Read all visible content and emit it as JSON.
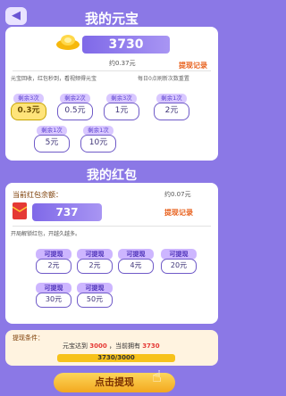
{
  "header": {
    "title": "我的元宝",
    "back_icon": "back-arrow-icon"
  },
  "yuanbao": {
    "balance": "3730",
    "approx": "约0.37元",
    "record_link": "提现记录",
    "tip": "元宝回收，红包秒到，看视频得元宝",
    "daily_tip": "每日0点刷新次数重置",
    "options": [
      {
        "remain": "剩余3次",
        "value": "0.3元",
        "selected": true
      },
      {
        "remain": "剩余2次",
        "value": "0.5元",
        "selected": false
      },
      {
        "remain": "剩余3次",
        "value": "1元",
        "selected": false
      },
      {
        "remain": "剩余1次",
        "value": "2元",
        "selected": false
      },
      {
        "remain": "剩余1次",
        "value": "5元",
        "selected": false
      },
      {
        "remain": "剩余1次",
        "value": "10元",
        "selected": false
      }
    ]
  },
  "redpacket": {
    "section_title": "我的红包",
    "balance_label": "当前红包余额：",
    "balance": "737",
    "approx": "约0.07元",
    "record_link": "提现记录",
    "tip": "开局解锁红包，开越久越多。",
    "options": [
      {
        "tag": "可提现",
        "value": "2元"
      },
      {
        "tag": "可提现",
        "value": "2元"
      },
      {
        "tag": "可提现",
        "value": "4元"
      },
      {
        "tag": "可提现",
        "value": "20元"
      },
      {
        "tag": "可提现",
        "value": "30元"
      },
      {
        "tag": "可提现",
        "value": "50元"
      }
    ]
  },
  "condition": {
    "label": "提现条件：",
    "text_prefix": "元宝达到",
    "target": "3000",
    "text_mid": "，当前拥有",
    "current": "3730",
    "progress_text": "3730/3000",
    "progress": 1.0
  },
  "withdraw_button": {
    "label": "点击提现"
  },
  "colors": {
    "background": "#8b78e6",
    "accent": "#e8601c",
    "primary": "#7f69e8"
  }
}
